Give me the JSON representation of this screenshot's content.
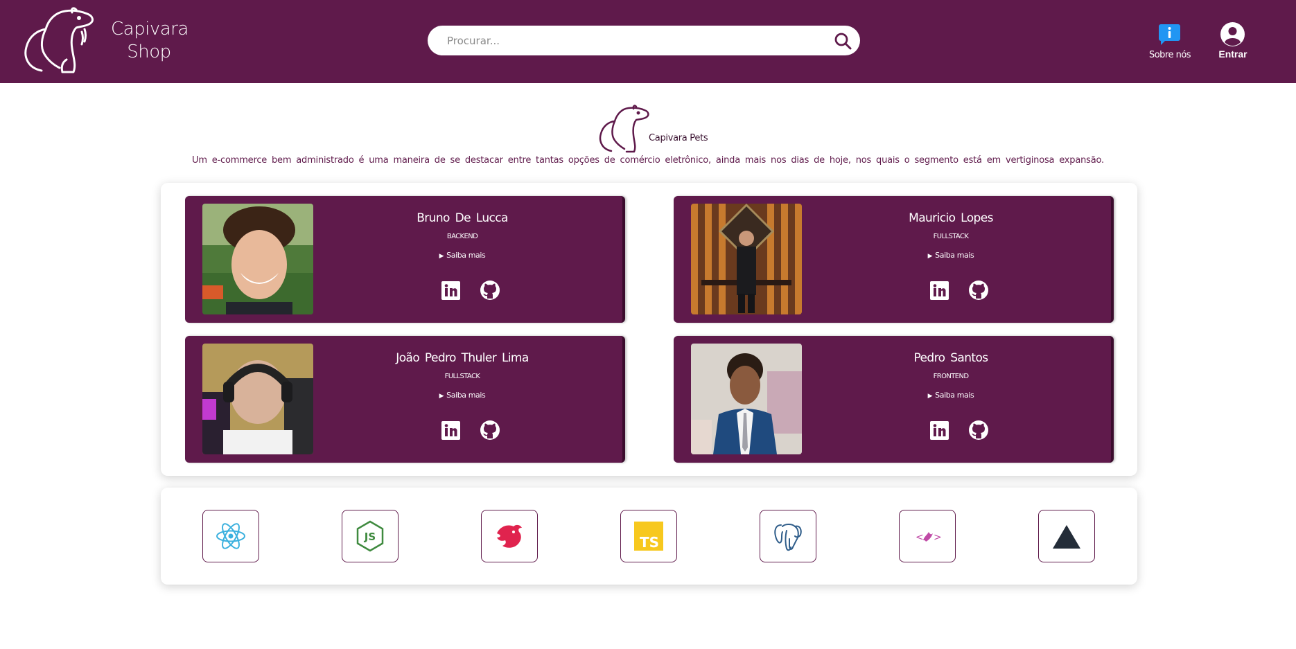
{
  "header": {
    "brand_line1": "Capivara",
    "brand_line2": "Shop",
    "search_placeholder": "Procurar...",
    "about_label": "Sobre nós",
    "login_label": "Entrar"
  },
  "intro": {
    "title": "Capivara Pets",
    "description": "Um e-commerce bem administrado é uma maneira de se destacar entre tantas opções de comércio eletrônico, ainda mais nos dias de hoje, nos quais o segmento está em vertiginosa expansão."
  },
  "team": [
    {
      "name": "Bruno De Lucca",
      "role": "BACKEND",
      "more": "Saiba mais"
    },
    {
      "name": "Mauricio Lopes",
      "role": "FULLSTACK",
      "more": "Saiba mais"
    },
    {
      "name": "João Pedro Thuler Lima",
      "role": "FULLSTACK",
      "more": "Saiba mais"
    },
    {
      "name": "Pedro Santos",
      "role": "FRONTEND",
      "more": "Saiba mais"
    }
  ],
  "technologies": [
    {
      "icon": "react-icon"
    },
    {
      "icon": "nodejs-icon"
    },
    {
      "icon": "nestjs-icon"
    },
    {
      "icon": "typescript-icon"
    },
    {
      "icon": "postgresql-icon"
    },
    {
      "icon": "styled-components-icon"
    },
    {
      "icon": "vercel-icon"
    }
  ],
  "colors": {
    "brand": "#5f1a4b",
    "about_bubble": "#2196f3",
    "typescript": "#f7c81e",
    "react": "#3ab0de",
    "nodejs": "#3f8a3f",
    "nestjs": "#e0234e"
  }
}
